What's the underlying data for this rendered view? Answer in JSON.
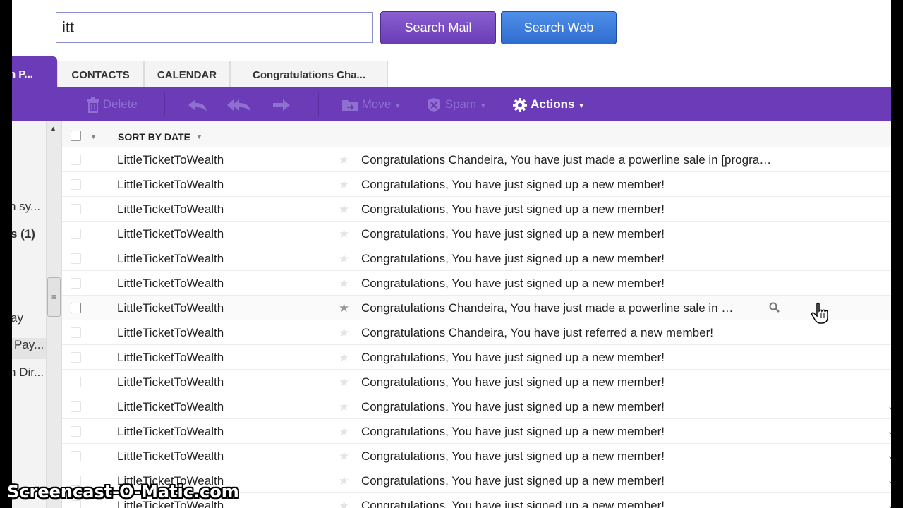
{
  "search": {
    "value": "itt",
    "mail_button": "Search Mail",
    "web_button": "Search Web"
  },
  "tabs": {
    "active_label": "h P...",
    "items": [
      "CONTACTS",
      "CALENDAR",
      "Congratulations Cha..."
    ]
  },
  "toolbar": {
    "delete": "Delete",
    "move": "Move",
    "spam": "Spam",
    "actions": "Actions"
  },
  "sidebar": {
    "items": [
      "h sy...",
      "s (1)",
      "ay",
      "Pay...",
      "h Dir..."
    ]
  },
  "list": {
    "sort_label": "SORT BY DATE",
    "rows": [
      {
        "from": "LittleTicketToWealth",
        "subject": "Congratulations Chandeira, You have just made a powerline sale in [progra…"
      },
      {
        "from": "LittleTicketToWealth",
        "subject": "Congratulations, You have just signed up a new member!"
      },
      {
        "from": "LittleTicketToWealth",
        "subject": "Congratulations, You have just signed up a new member!"
      },
      {
        "from": "LittleTicketToWealth",
        "subject": "Congratulations, You have just signed up a new member!"
      },
      {
        "from": "LittleTicketToWealth",
        "subject": "Congratulations, You have just signed up a new member!"
      },
      {
        "from": "LittleTicketToWealth",
        "subject": "Congratulations, You have just signed up a new member!"
      },
      {
        "from": "LittleTicketToWealth",
        "subject": "Congratulations Chandeira, You have just made a powerline sale in …"
      },
      {
        "from": "LittleTicketToWealth",
        "subject": "Congratulations Chandeira, You have just referred a new member!"
      },
      {
        "from": "LittleTicketToWealth",
        "subject": "Congratulations, You have just signed up a new member!"
      },
      {
        "from": "LittleTicketToWealth",
        "subject": "Congratulations, You have just signed up a new member!"
      },
      {
        "from": "LittleTicketToWealth",
        "subject": "Congratulations, You have just signed up a new member!"
      },
      {
        "from": "LittleTicketToWealth",
        "subject": "Congratulations, You have just signed up a new member!"
      },
      {
        "from": "LittleTicketToWealth",
        "subject": "Congratulations, You have just signed up a new member!"
      },
      {
        "from": "LittleTicketToWealth",
        "subject": "Congratulations, You have just signed up a new member!"
      },
      {
        "from": "LittleTicketToWealth",
        "subject": "Congratulations, You have just signed up a new member!"
      }
    ]
  },
  "watermark": "Screencast-O-Matic.com",
  "colors": {
    "toolbar": "#6b3bb8",
    "search_mail": "#7a4cc4",
    "search_web": "#3b7ddd"
  }
}
